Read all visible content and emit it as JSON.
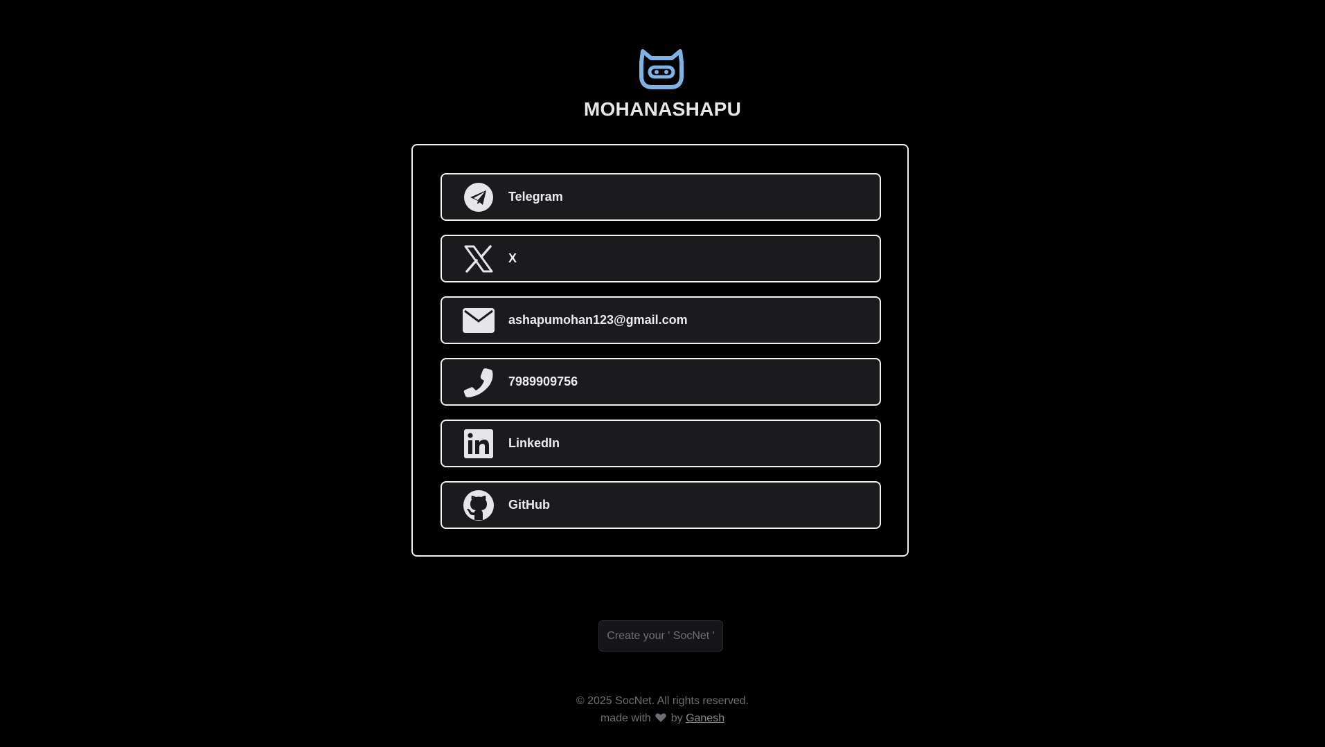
{
  "header": {
    "logo_icon": "robot-face-icon",
    "username": "MOHANASHAPU",
    "accent_color": "#7fb3e6"
  },
  "links": [
    {
      "icon": "telegram-icon",
      "label": "Telegram"
    },
    {
      "icon": "x-icon",
      "label": "X"
    },
    {
      "icon": "mail-icon",
      "label": "ashapumohan123@gmail.com"
    },
    {
      "icon": "phone-icon",
      "label": "7989909756"
    },
    {
      "icon": "linkedin-icon",
      "label": "LinkedIn"
    },
    {
      "icon": "github-icon",
      "label": "GitHub"
    }
  ],
  "cta": {
    "label": "Create your ' SocNet '"
  },
  "footer": {
    "copyright": "© 2025 SocNet. All rights reserved.",
    "made_with_prefix": "made with",
    "heart_icon": "heart-icon",
    "by_text": "by",
    "author": "Ganesh"
  }
}
